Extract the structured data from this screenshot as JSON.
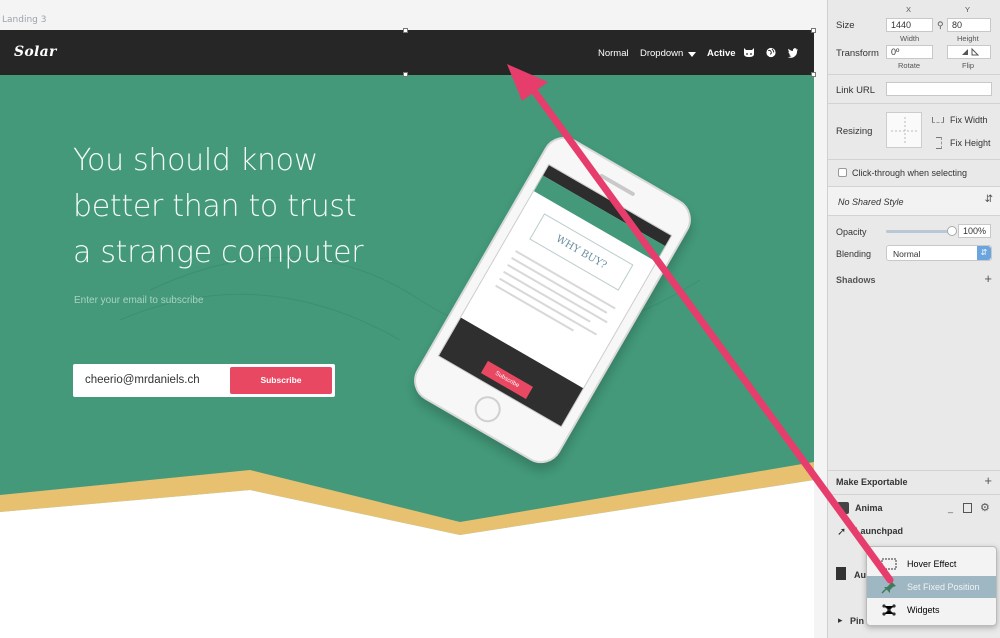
{
  "canvas": {
    "artboard_label": "Landing 3"
  },
  "navbar": {
    "logo": "Solar",
    "links": [
      "Normal",
      "Dropdown",
      "Active"
    ],
    "icons": [
      "github-icon",
      "globe-icon",
      "twitter-icon"
    ]
  },
  "hero": {
    "headline_lines": [
      "You should know",
      "better than to trust",
      "a strange computer"
    ],
    "subtitle": "Enter your email to subscribe",
    "email_value": "cheerio@mrdaniels.ch",
    "subscribe_label": "Subscribe",
    "colors": {
      "green": "#43997a",
      "yellow": "#e8c170",
      "pink": "#e94863",
      "nav": "#262626"
    }
  },
  "phone": {
    "screen_title": "WHY BUY?",
    "screen_button": "Subscribe"
  },
  "inspector": {
    "xy_labels": {
      "x": "X",
      "y": "Y"
    },
    "size": {
      "label": "Size",
      "width": "1440",
      "height": "80",
      "width_label": "Width",
      "height_label": "Height"
    },
    "transform": {
      "label": "Transform",
      "rotate": "0º",
      "rotate_label": "Rotate",
      "flip_label": "Flip"
    },
    "link_url": {
      "label": "Link URL",
      "value": ""
    },
    "resizing": {
      "label": "Resizing",
      "fix_width": "Fix Width",
      "fix_height": "Fix Height"
    },
    "click_through": "Click-through when selecting",
    "shared_style": "No Shared Style",
    "opacity": {
      "label": "Opacity",
      "value": "100%"
    },
    "blending": {
      "label": "Blending",
      "value": "Normal"
    },
    "shadows": "Shadows",
    "make_exportable": "Make Exportable",
    "anima": "Anima",
    "launchpad": "Launchpad",
    "auto_partial": "Au",
    "pin_partial": "Pin"
  },
  "context_menu": {
    "items": [
      "Hover Effect",
      "Set Fixed Position",
      "Widgets"
    ],
    "highlighted_index": 1
  }
}
